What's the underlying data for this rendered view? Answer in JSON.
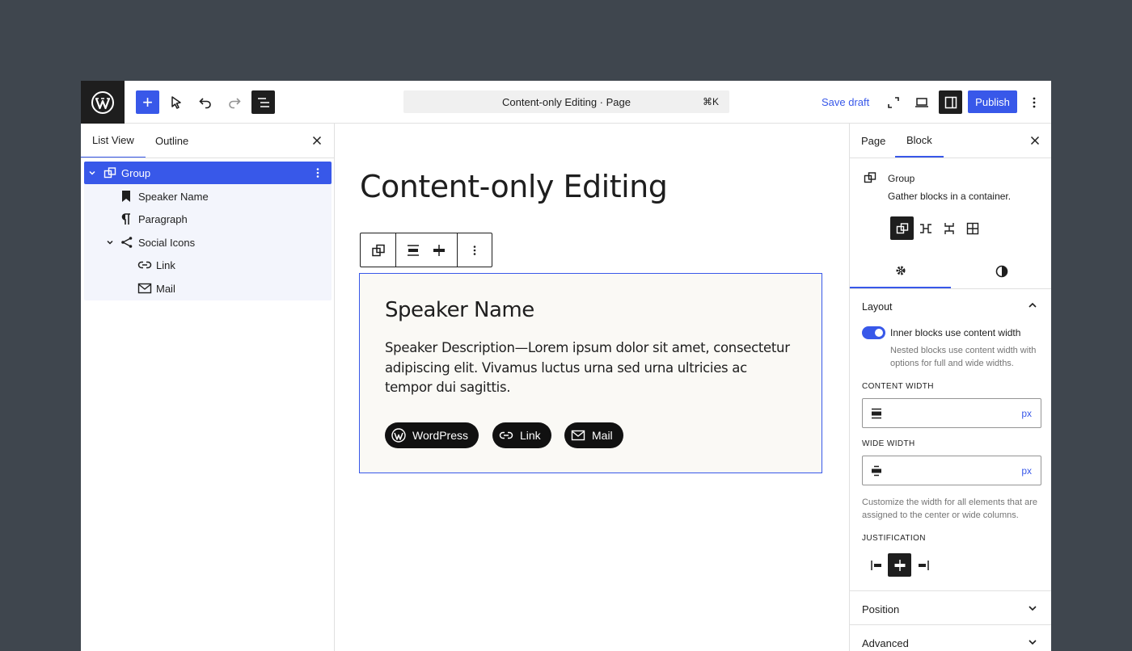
{
  "topbar": {
    "command_title": "Content-only Editing · Page",
    "command_shortcut": "⌘K",
    "save_draft": "Save draft",
    "publish": "Publish"
  },
  "left_panel": {
    "tabs": [
      "List View",
      "Outline"
    ],
    "items": [
      {
        "label": "Group",
        "icon": "group-icon",
        "expanded": true,
        "selected": true
      },
      {
        "label": "Speaker Name",
        "icon": "bookmark-icon"
      },
      {
        "label": "Paragraph",
        "icon": "pilcrow-icon"
      },
      {
        "label": "Social Icons",
        "icon": "share-icon",
        "expanded": true
      },
      {
        "label": "Link",
        "icon": "link-icon"
      },
      {
        "label": "Mail",
        "icon": "mail-icon"
      }
    ]
  },
  "canvas": {
    "page_title": "Content-only Editing",
    "speaker_name": "Speaker Name",
    "speaker_description": "Speaker Description—Lorem ipsum dolor sit amet, consectetur adipiscing elit. Vivamus luctus urna sed urna ultricies ac tempor dui sagittis.",
    "social_links": [
      {
        "label": "WordPress",
        "icon": "wordpress-icon"
      },
      {
        "label": "Link",
        "icon": "link-icon"
      },
      {
        "label": "Mail",
        "icon": "mail-icon"
      }
    ]
  },
  "right_panel": {
    "tabs": [
      "Page",
      "Block"
    ],
    "block_name": "Group",
    "block_description": "Gather blocks in a container.",
    "layout": {
      "title": "Layout",
      "toggle_label": "Inner blocks use content width",
      "toggle_on": true,
      "toggle_help": "Nested blocks use content width with options for full and wide widths.",
      "content_width_label": "CONTENT WIDTH",
      "content_width_unit": "px",
      "wide_width_label": "WIDE WIDTH",
      "wide_width_unit": "px",
      "width_help": "Customize the width for all elements that are assigned to the center or wide columns.",
      "justification_label": "JUSTIFICATION"
    },
    "collapsed_panels": [
      "Position",
      "Advanced"
    ]
  },
  "colors": {
    "accent": "#3858e9",
    "dark": "#1e1e1e",
    "chrome": "#3f464e",
    "canvas_group_bg": "#faf9f5"
  }
}
